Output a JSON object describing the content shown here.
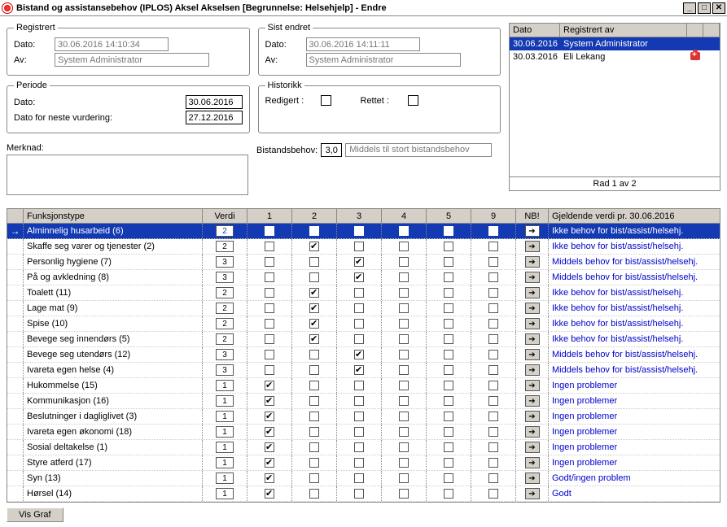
{
  "window": {
    "title": "Bistand og assistansebehov (IPLOS) Aksel Akselsen  [Begrunnelse: Helsehjelp] - Endre"
  },
  "registrert": {
    "legend": "Registrert",
    "dato_label": "Dato:",
    "dato": "30.06.2016 14:10:34",
    "av_label": "Av:",
    "av": "System Administrator"
  },
  "sist_endret": {
    "legend": "Sist endret",
    "dato_label": "Dato:",
    "dato": "30.06.2016 14:11:11",
    "av_label": "Av:",
    "av": "System Administrator"
  },
  "periode": {
    "legend": "Periode",
    "dato_label": "Dato:",
    "dato": "30.06.2016",
    "neste_label": "Dato for neste vurdering:",
    "neste": "27.12.2016"
  },
  "historikk": {
    "legend": "Historikk",
    "redigert_label": "Redigert :",
    "rettet_label": "Rettet :"
  },
  "merknad_label": "Merknad:",
  "bistand": {
    "label": "Bistandsbehov:",
    "value": "3,0",
    "desc": "Middels til stort bistandsbehov"
  },
  "log": {
    "col_date": "Dato",
    "col_user": "Registrert av",
    "rows": [
      {
        "date": "30.06.2016",
        "user": "System Administrator",
        "icon": ""
      },
      {
        "date": "30.03.2016",
        "user": "Eli Lekang",
        "icon": "med"
      }
    ],
    "pager": "Rad 1 av 2"
  },
  "grid": {
    "head": {
      "c1": "",
      "c2": "Funksjonstype",
      "c3": "Verdi",
      "c4": "1",
      "c5": "2",
      "c6": "3",
      "c7": "4",
      "c8": "5",
      "c9": "9",
      "c10": "NB!",
      "c11": "Gjeldende verdi pr. 30.06.2016"
    },
    "rows": [
      {
        "sel": true,
        "name": "Alminnelig husarbeid   (6)",
        "val": "2",
        "chk": 2,
        "link": "Ikke behov for bist/assist/helsehj."
      },
      {
        "name": "Skaffe seg varer og tjenester   (2)",
        "val": "2",
        "chk": 2,
        "link": "Ikke behov for bist/assist/helsehj."
      },
      {
        "name": "Personlig hygiene   (7)",
        "val": "3",
        "chk": 3,
        "link": "Middels behov for bist/assist/helsehj."
      },
      {
        "name": "På og avkledning   (8)",
        "val": "3",
        "chk": 3,
        "link": "Middels behov for bist/assist/helsehj."
      },
      {
        "name": "Toalett   (11)",
        "val": "2",
        "chk": 2,
        "link": "Ikke behov for bist/assist/helsehj."
      },
      {
        "name": "Lage mat   (9)",
        "val": "2",
        "chk": 2,
        "link": "Ikke behov for bist/assist/helsehj."
      },
      {
        "name": "Spise   (10)",
        "val": "2",
        "chk": 2,
        "link": "Ikke behov for bist/assist/helsehj."
      },
      {
        "name": "Bevege seg innendørs   (5)",
        "val": "2",
        "chk": 2,
        "link": "Ikke behov for bist/assist/helsehj."
      },
      {
        "name": "Bevege seg utendørs   (12)",
        "val": "3",
        "chk": 3,
        "link": "Middels behov for bist/assist/helsehj."
      },
      {
        "name": "Ivareta egen helse   (4)",
        "val": "3",
        "chk": 3,
        "link": "Middels behov for bist/assist/helsehj."
      },
      {
        "name": "Hukommelse   (15)",
        "val": "1",
        "chk": 1,
        "link": "Ingen problemer"
      },
      {
        "name": "Kommunikasjon   (16)",
        "val": "1",
        "chk": 1,
        "link": "Ingen problemer"
      },
      {
        "name": "Beslutninger i dagliglivet   (3)",
        "val": "1",
        "chk": 1,
        "link": "Ingen problemer"
      },
      {
        "name": "Ivareta egen økonomi   (18)",
        "val": "1",
        "chk": 1,
        "link": "Ingen problemer"
      },
      {
        "name": "Sosial deltakelse   (1)",
        "val": "1",
        "chk": 1,
        "link": "Ingen problemer"
      },
      {
        "name": "Styre atferd   (17)",
        "val": "1",
        "chk": 1,
        "link": "Ingen problemer"
      },
      {
        "name": "Syn   (13)",
        "val": "1",
        "chk": 1,
        "link": "Godt/ingen problem"
      },
      {
        "name": "Hørsel   (14)",
        "val": "1",
        "chk": 1,
        "link": "Godt"
      }
    ]
  },
  "buttons": {
    "vis_graf": "Vis Graf"
  }
}
